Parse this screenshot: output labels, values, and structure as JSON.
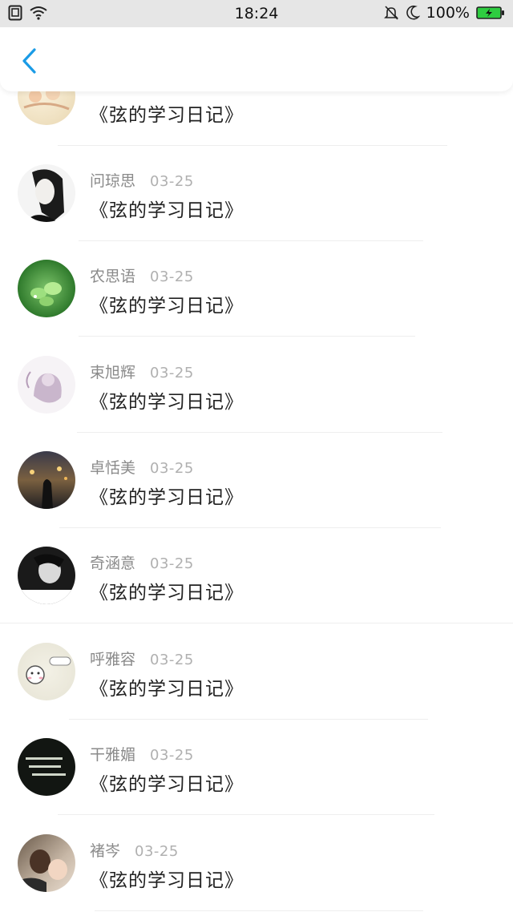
{
  "status_bar": {
    "time": "18:24",
    "battery_text": "100%",
    "icons": [
      "sim-icon",
      "wifi-icon",
      "mute-bell-icon",
      "moon-icon",
      "battery-charging-icon"
    ]
  },
  "nav": {
    "back_icon": "chevron-left-icon",
    "accent": "#1a9be6"
  },
  "posts": [
    {
      "name": "",
      "date": "",
      "title": "《弦的学习日记》"
    },
    {
      "name": "问琼思",
      "date": "03-25",
      "title": "《弦的学习日记》"
    },
    {
      "name": "农思语",
      "date": "03-25",
      "title": "《弦的学习日记》"
    },
    {
      "name": "束旭辉",
      "date": "03-25",
      "title": "《弦的学习日记》"
    },
    {
      "name": "卓恬美",
      "date": "03-25",
      "title": "《弦的学习日记》"
    },
    {
      "name": "奇涵意",
      "date": "03-25",
      "title": "《弦的学习日记》"
    },
    {
      "name": "呼雅容",
      "date": "03-25",
      "title": "《弦的学习日记》"
    },
    {
      "name": "干雅媚",
      "date": "03-25",
      "title": "《弦的学习日记》"
    },
    {
      "name": "褚岑",
      "date": "03-25",
      "title": "《弦的学习日记》"
    }
  ]
}
